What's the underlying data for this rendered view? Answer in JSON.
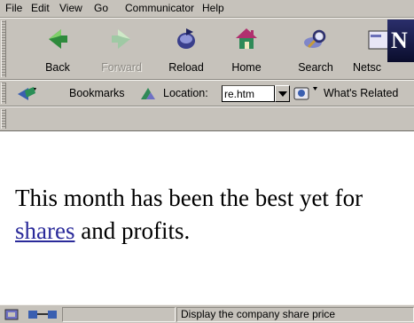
{
  "menu": {
    "items": [
      {
        "label": "File",
        "name": "menu-file"
      },
      {
        "label": "Edit",
        "name": "menu-edit"
      },
      {
        "label": "View",
        "name": "menu-view"
      },
      {
        "label": "Go",
        "name": "menu-go"
      },
      {
        "label": "Communicator",
        "name": "menu-communicator"
      },
      {
        "label": "Help",
        "name": "menu-help"
      }
    ]
  },
  "toolbar": {
    "back": "Back",
    "forward": "Forward",
    "reload": "Reload",
    "home": "Home",
    "search": "Search",
    "netscape": "Netsc"
  },
  "logo_letter": "N",
  "location_bar": {
    "bookmarks": "Bookmarks",
    "location_label": "Location:",
    "location_value": "re.htm",
    "whats_related": "What's Related"
  },
  "page": {
    "text_before": "This month has been the best yet for ",
    "link_text": "shares",
    "text_after": " and profits."
  },
  "status": {
    "message": "Display the company share price"
  },
  "colors": {
    "chrome": "#c6c2bb",
    "link": "#2a2a9a",
    "page_background": "#ffffff"
  }
}
